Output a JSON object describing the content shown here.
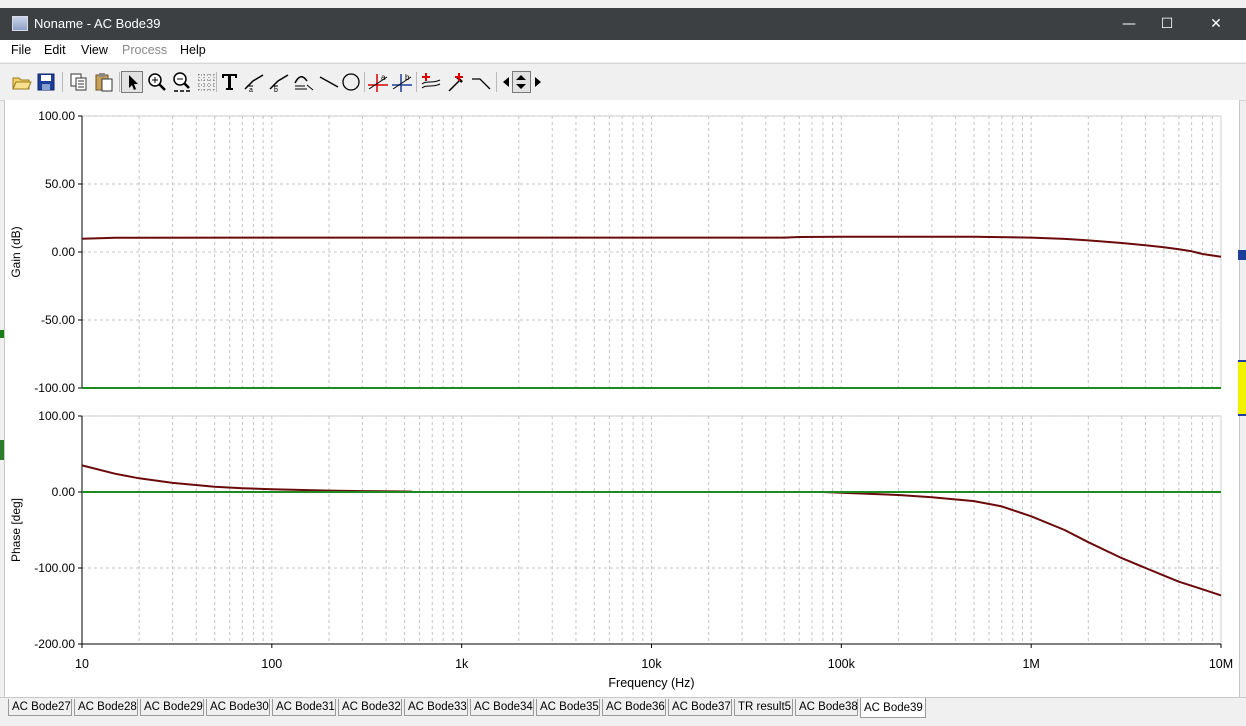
{
  "window": {
    "title": "Noname - AC Bode39",
    "controls": {
      "minimize": "—",
      "maximize": "☐",
      "close": "✕"
    }
  },
  "menu": [
    "File",
    "Edit",
    "View",
    "Process",
    "Help"
  ],
  "menu_disabled": [
    "Process"
  ],
  "toolbar_icons": [
    "open-folder-icon",
    "save-icon",
    "copy-icon",
    "paste-icon",
    "pointer-icon",
    "zoom-in-icon",
    "zoom-out-100-icon",
    "grid-icon",
    "text-icon",
    "cursor-a-icon",
    "cursor-b-icon",
    "curve-icon",
    "line-icon",
    "circle-icon",
    "marker-a-icon",
    "marker-b-icon",
    "add-trace-icon",
    "probe-icon",
    "slope-icon",
    "nav-left-icon",
    "nav-updown-icon",
    "nav-right-icon"
  ],
  "colors": {
    "trace": "#6b0a0a",
    "reference": "#1f8a1f",
    "grid": "#c4c4c4"
  },
  "chart_data": [
    {
      "type": "line",
      "ylabel": "Gain (dB)",
      "xscale": "log",
      "xlim": [
        10,
        10000000
      ],
      "ylim": [
        -100,
        100
      ],
      "yticks": [
        100,
        50,
        0,
        -50,
        -100
      ],
      "ytick_labels": [
        "100.00",
        "50.00",
        "0.00",
        "-50.00",
        "-100.00"
      ],
      "grid": true,
      "series": [
        {
          "role": "trace",
          "x": [
            10,
            15,
            100,
            1000,
            10000,
            50000,
            60000,
            100000,
            500000,
            1000000,
            1500000,
            2000000,
            3000000,
            4000000,
            5000000,
            6000000,
            7000000,
            8000000,
            10000000
          ],
          "y": [
            9.7,
            10.5,
            10.6,
            10.6,
            10.6,
            10.6,
            11.0,
            11.2,
            11.2,
            10.6,
            9.6,
            8.5,
            6.6,
            4.9,
            3.5,
            2.0,
            0.5,
            -1.5,
            -3.5
          ]
        },
        {
          "role": "reference",
          "x": [
            10,
            10000000
          ],
          "y": [
            -100,
            -100
          ]
        }
      ]
    },
    {
      "type": "line",
      "ylabel": "Phase [deg]",
      "xlabel": "Frequency (Hz)",
      "xscale": "log",
      "xlim": [
        10,
        10000000
      ],
      "ylim": [
        -200,
        100
      ],
      "yticks": [
        100,
        0,
        -100,
        -200
      ],
      "ytick_labels": [
        "100.00",
        "0.00",
        "-100.00",
        "-200.00"
      ],
      "xticks": [
        10,
        100,
        1000,
        10000,
        100000,
        1000000,
        10000000
      ],
      "xtick_labels": [
        "10",
        "100",
        "1k",
        "10k",
        "100k",
        "1M",
        "10M"
      ],
      "grid": true,
      "series": [
        {
          "role": "trace",
          "x": [
            10,
            15,
            20,
            30,
            50,
            70,
            100,
            200,
            300,
            500,
            550
          ],
          "y": [
            35,
            24,
            18,
            12,
            7,
            5,
            3.5,
            1.8,
            1.2,
            0.7,
            0.5
          ]
        },
        {
          "role": "trace",
          "x": [
            80000,
            100000,
            200000,
            300000,
            500000,
            700000,
            1000000,
            1500000,
            2000000,
            3000000,
            4000000,
            5000000,
            6000000,
            8000000,
            10000000
          ],
          "y": [
            0,
            -1,
            -4,
            -7,
            -12,
            -19,
            -32,
            -50,
            -66,
            -87,
            -100,
            -110,
            -118,
            -128,
            -136
          ]
        },
        {
          "role": "reference",
          "x": [
            10,
            10000000
          ],
          "y": [
            0,
            0
          ]
        }
      ]
    }
  ],
  "tabs": [
    "AC Bode27",
    "AC Bode28",
    "AC Bode29",
    "AC Bode30",
    "AC Bode31",
    "AC Bode32",
    "AC Bode33",
    "AC Bode34",
    "AC Bode35",
    "AC Bode36",
    "AC Bode37",
    "TR result5",
    "AC Bode38",
    "AC Bode39"
  ],
  "active_tab": "AC Bode39"
}
